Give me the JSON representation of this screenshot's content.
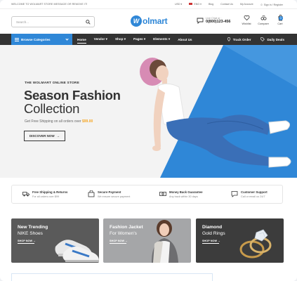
{
  "topbar": {
    "welcome": "WELCOME TO WOLMART STORE MESSAGE OR REMOVE IT!",
    "currency": "USD",
    "language": "ENG",
    "links": [
      "Blog",
      "Contact Us",
      "My Account",
      "Sign in / Register"
    ]
  },
  "header": {
    "search_placeholder": "Search...",
    "logo_mark": "W",
    "logo_text": "olmart",
    "live_label": "Live Chat or :",
    "phone": "0(800)123-456",
    "icons": [
      {
        "name": "heart-icon",
        "label": "Wishlist"
      },
      {
        "name": "compare-icon",
        "label": "Compare"
      },
      {
        "name": "cart-icon",
        "label": "Cart"
      }
    ],
    "cart_count": "0"
  },
  "nav": {
    "browse": "Browse Categories",
    "items": [
      "Home",
      "Vendor",
      "Shop",
      "Pages",
      "Elements",
      "About Us"
    ],
    "right": [
      "Track Order",
      "Daily Deals"
    ]
  },
  "hero": {
    "subtitle": "THE WOLMART ONLINE STORE",
    "title_bold": "Season Fashion",
    "title_light": "Collection",
    "shipping_text": "Get Free Shipping on all orders over ",
    "shipping_price": "$99.00",
    "button": "DISCOVER NOW"
  },
  "features": [
    {
      "title": "Free Shipping & Returns",
      "sub": "For all orders over $99",
      "icon": "truck-icon"
    },
    {
      "title": "Secure Payment",
      "sub": "We ensure secure payment",
      "icon": "bag-icon"
    },
    {
      "title": "Money Back Guarantee",
      "sub": "Any back within 30 days",
      "icon": "money-icon"
    },
    {
      "title": "Customer Support",
      "sub": "Call or email us 24/7",
      "icon": "chat-icon"
    }
  ],
  "banners": [
    {
      "title": "New Trending",
      "sub": "NIKE Shoes",
      "link": "SHOP NOW"
    },
    {
      "title": "Fashion Jacket",
      "sub": "For Women's",
      "link": "SHOP NOW"
    },
    {
      "title": "Diamond",
      "sub": "Gold Rings",
      "link": "SHOP NOW"
    }
  ],
  "colors": {
    "accent": "#2f87d7",
    "nav": "#333333",
    "price": "#f5a623"
  }
}
